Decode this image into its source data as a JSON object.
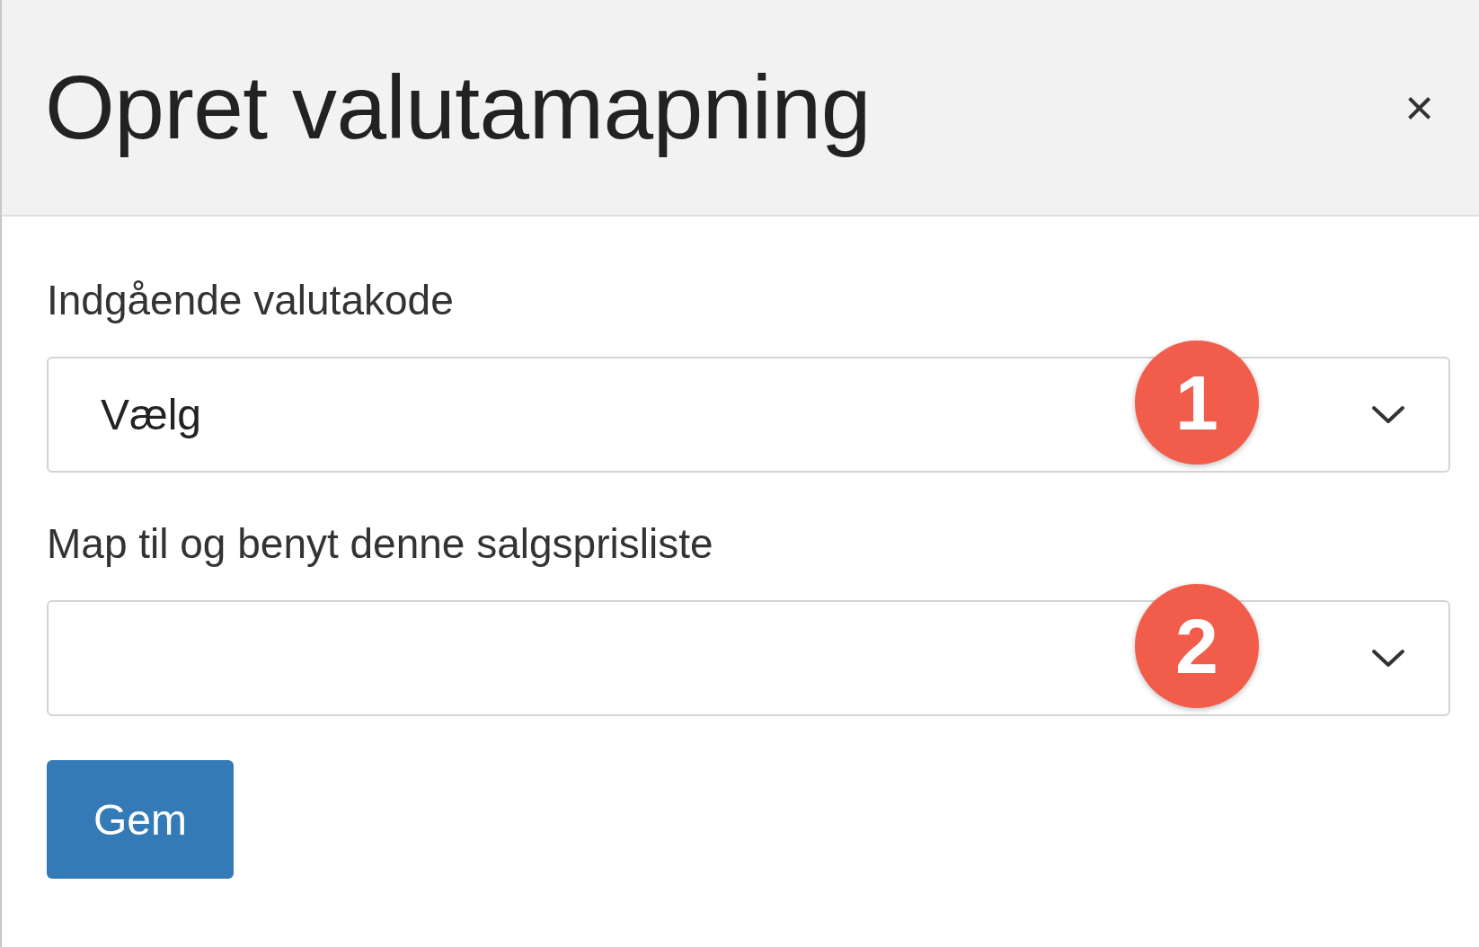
{
  "dialog": {
    "title": "Opret valutamapning",
    "close": "×"
  },
  "fields": [
    {
      "label": "Indgående valutakode",
      "value": "Vælg",
      "marker": "1"
    },
    {
      "label": "Map til og benyt denne salgsprisliste",
      "marker": "2"
    }
  ],
  "save_button": "Gem"
}
